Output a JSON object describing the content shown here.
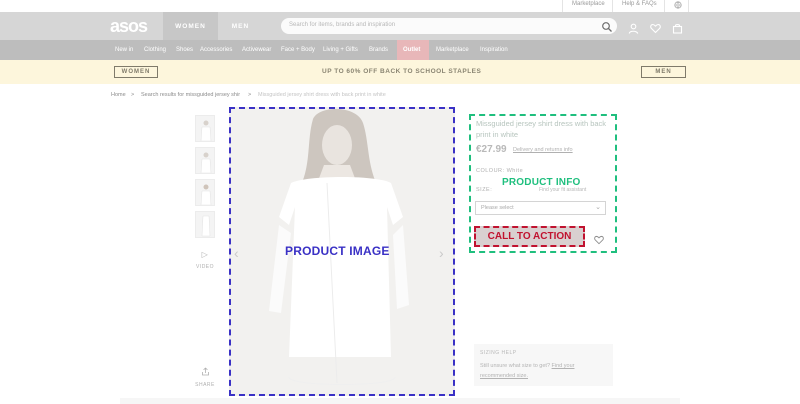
{
  "util_bar": {
    "marketplace": "Marketplace",
    "help": "Help & FAQs"
  },
  "header": {
    "logo": "asos",
    "tabs": [
      "WOMEN",
      "MEN"
    ],
    "search_placeholder": "Search for items, brands and inspiration"
  },
  "category_nav": [
    "New in",
    "Clothing",
    "Shoes",
    "Accessories",
    "Activewear",
    "Face + Body",
    "Living + Gifts",
    "Brands",
    "Outlet",
    "Marketplace",
    "Inspiration"
  ],
  "promo": {
    "left_button": "WOMEN",
    "text": "UP TO 60% OFF BACK TO SCHOOL STAPLES",
    "right_button": "MEN"
  },
  "breadcrumb": {
    "home": "Home",
    "sep": ">",
    "search": "Search results for missguided jersey shir",
    "current": "Missguided jersey shirt dress with back print in white"
  },
  "gallery": {
    "video_label": "VIDEO",
    "share_label": "SHARE",
    "overlay_label": "PRODUCT IMAGE"
  },
  "product_info": {
    "title": "Missguided jersey shirt dress with back print in white",
    "price": "€27.99",
    "delivery_link": "Delivery and returns info",
    "colour": "COLOUR: White",
    "size_label": "SIZE:",
    "fit_note": "Find your fit assistant",
    "size_placeholder": "Please select",
    "overlay_label": "PRODUCT INFO"
  },
  "cta": {
    "label": "CALL TO ACTION"
  },
  "sizing_help": {
    "heading": "SIZING HELP",
    "text_before": "Still unsure what size to get? ",
    "link": "Find your recommended size."
  },
  "colors": {
    "image_outline": "#3a31c5",
    "info_outline": "#1fbf7e",
    "cta_outline": "#c1122f"
  }
}
